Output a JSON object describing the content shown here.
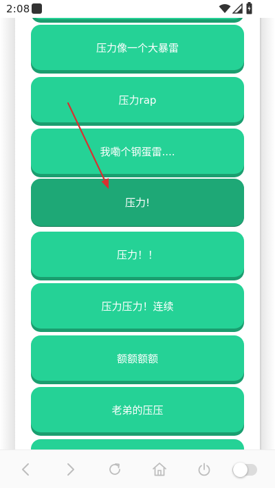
{
  "status_bar": {
    "time": "2:08",
    "icons": [
      "notification-icon",
      "wifi-icon",
      "signal-icon",
      "battery-icon"
    ]
  },
  "buttons": [
    {
      "label": "压力像一个大暴雷",
      "pressed": false
    },
    {
      "label": "压力rap",
      "pressed": false
    },
    {
      "label": "我嘞个钢蛋雷....",
      "pressed": false
    },
    {
      "label": "压力!",
      "pressed": true
    },
    {
      "label": "压力！！",
      "pressed": false
    },
    {
      "label": "压力压力！连续",
      "pressed": false
    },
    {
      "label": "额额额额",
      "pressed": false
    },
    {
      "label": "老弟的压压",
      "pressed": false
    }
  ],
  "colors": {
    "button": "#25d296",
    "button_shadow": "#1a9e6f",
    "button_pressed": "#1ea876",
    "arrow": "#d83030"
  },
  "bottom_bar": {
    "icons": [
      "back-icon",
      "forward-icon",
      "refresh-icon",
      "home-icon",
      "power-icon",
      "toggle-switch"
    ]
  }
}
